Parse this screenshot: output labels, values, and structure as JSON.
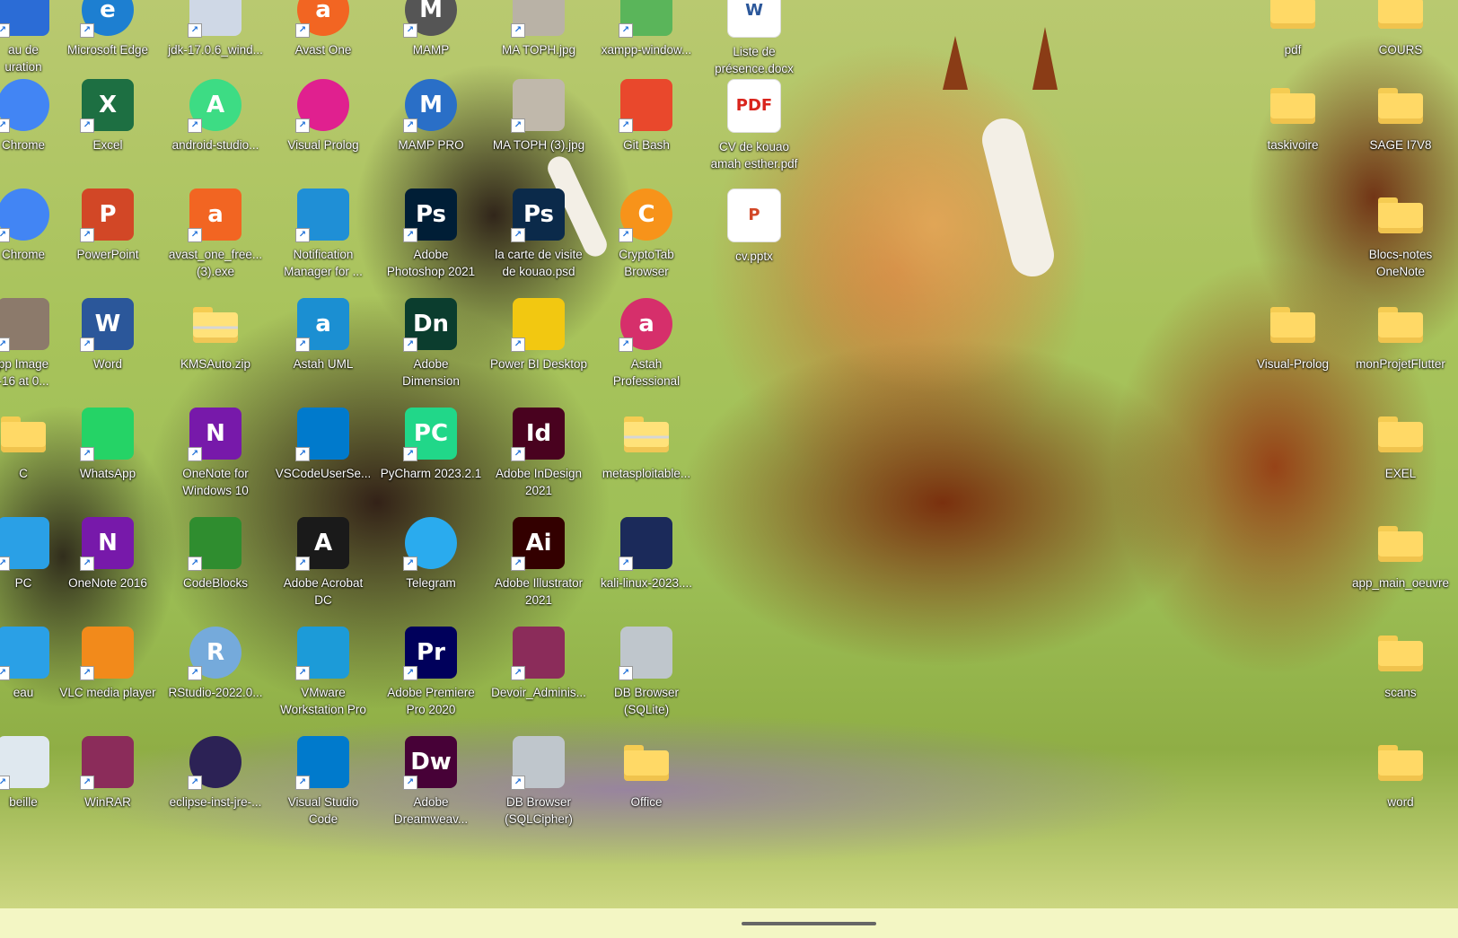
{
  "desktop": {
    "icons": [
      {
        "label": "au de\nuration",
        "name": "icon-control-panel",
        "color": "#2b6cd6",
        "glyph": "",
        "kind": "app"
      },
      {
        "label": "Microsoft Edge",
        "name": "icon-microsoft-edge",
        "color": "#1d7fd1",
        "glyph": "e",
        "kind": "round"
      },
      {
        "label": "jdk-17.0.6_wind...",
        "name": "icon-jdk-installer",
        "color": "#cfd8e6",
        "glyph": "",
        "kind": "app"
      },
      {
        "label": "Avast One",
        "name": "icon-avast-one",
        "color": "#f26522",
        "glyph": "a",
        "kind": "round"
      },
      {
        "label": "MAMP",
        "name": "icon-mamp",
        "color": "#555555",
        "glyph": "M",
        "kind": "round"
      },
      {
        "label": "MA TOPH.jpg",
        "name": "icon-ma-toph-jpg",
        "color": "#b9b2a6",
        "glyph": "",
        "kind": "app"
      },
      {
        "label": "xampp-window...",
        "name": "icon-xampp-installer",
        "color": "#5ab55a",
        "glyph": "",
        "kind": "app"
      },
      {
        "label": "Liste de\nprésence.docx",
        "name": "icon-liste-presence-docx",
        "color": "#2b579a",
        "glyph": "W",
        "kind": "doc"
      },
      {
        "label": "pdf",
        "name": "icon-folder-pdf",
        "kind": "folder"
      },
      {
        "label": "COURS",
        "name": "icon-folder-cours",
        "kind": "folder"
      },
      {
        "label": "Chrome",
        "name": "icon-chrome-1",
        "color": "#4285f4",
        "glyph": "",
        "kind": "round"
      },
      {
        "label": "Excel",
        "name": "icon-excel",
        "color": "#1d6f42",
        "glyph": "X",
        "kind": "app"
      },
      {
        "label": "android-studio...",
        "name": "icon-android-studio",
        "color": "#3ddc84",
        "glyph": "A",
        "kind": "round"
      },
      {
        "label": "Visual Prolog",
        "name": "icon-visual-prolog",
        "color": "#e0208f",
        "glyph": "",
        "kind": "round"
      },
      {
        "label": "MAMP PRO",
        "name": "icon-mamp-pro",
        "color": "#2a6fc7",
        "glyph": "M",
        "kind": "round"
      },
      {
        "label": "MA TOPH (3).jpg",
        "name": "icon-ma-toph-3-jpg",
        "color": "#c0b8ab",
        "glyph": "",
        "kind": "app"
      },
      {
        "label": "Git Bash",
        "name": "icon-git-bash",
        "color": "#e9482c",
        "glyph": "",
        "kind": "app"
      },
      {
        "label": "CV de kouao\namah esther.pdf",
        "name": "icon-cv-kouao-pdf",
        "color": "#d9241c",
        "glyph": "PDF",
        "kind": "doc"
      },
      {
        "label": "taskivoire",
        "name": "icon-folder-taskivoire",
        "kind": "folder"
      },
      {
        "label": "SAGE I7V8",
        "name": "icon-folder-sage",
        "kind": "folder"
      },
      {
        "label": "Chrome",
        "name": "icon-chrome-2",
        "color": "#4285f4",
        "glyph": "",
        "kind": "round"
      },
      {
        "label": "PowerPoint",
        "name": "icon-powerpoint",
        "color": "#d24726",
        "glyph": "P",
        "kind": "app"
      },
      {
        "label": "avast_one_free...\n(3).exe",
        "name": "icon-avast-installer",
        "color": "#f26522",
        "glyph": "a",
        "kind": "app"
      },
      {
        "label": "Notification\nManager for ...",
        "name": "icon-notification-manager",
        "color": "#1f8fd6",
        "glyph": "",
        "kind": "app"
      },
      {
        "label": "Adobe\nPhotoshop 2021",
        "name": "icon-photoshop",
        "color": "#001e36",
        "glyph": "Ps",
        "kind": "app"
      },
      {
        "label": "la carte de visite\nde kouao.psd",
        "name": "icon-carte-visite-psd",
        "color": "#0b2a4a",
        "glyph": "Ps",
        "kind": "app"
      },
      {
        "label": "CryptoTab\nBrowser",
        "name": "icon-cryptotab",
        "color": "#f7931a",
        "glyph": "C",
        "kind": "round"
      },
      {
        "label": "cv.pptx",
        "name": "icon-cv-pptx",
        "color": "#d24726",
        "glyph": "P",
        "kind": "doc"
      },
      {
        "label": "Blocs-notes\nOneNote",
        "name": "icon-folder-blocs-notes",
        "kind": "folder"
      },
      {
        "label": "pp Image\n-16 at 0...",
        "name": "icon-image-file",
        "color": "#8c7a6b",
        "glyph": "",
        "kind": "app"
      },
      {
        "label": "Word",
        "name": "icon-word",
        "color": "#2b579a",
        "glyph": "W",
        "kind": "app"
      },
      {
        "label": "KMSAuto.zip",
        "name": "icon-kmsauto-zip",
        "kind": "zip"
      },
      {
        "label": "Astah UML",
        "name": "icon-astah-uml",
        "color": "#1b8fd2",
        "glyph": "a",
        "kind": "app"
      },
      {
        "label": "Adobe\nDimension",
        "name": "icon-adobe-dimension",
        "color": "#0b3d2e",
        "glyph": "Dn",
        "kind": "app"
      },
      {
        "label": "Power BI Desktop",
        "name": "icon-power-bi",
        "color": "#f2c811",
        "glyph": "",
        "kind": "app"
      },
      {
        "label": "Astah\nProfessional",
        "name": "icon-astah-professional",
        "color": "#d62f6b",
        "glyph": "a",
        "kind": "round"
      },
      {
        "label": "Visual-Prolog",
        "name": "icon-folder-visual-prolog",
        "kind": "folder"
      },
      {
        "label": "monProjetFlutter",
        "name": "icon-folder-flutter",
        "kind": "folder"
      },
      {
        "label": "C",
        "name": "icon-folder-c",
        "kind": "folder"
      },
      {
        "label": "WhatsApp",
        "name": "icon-whatsapp",
        "color": "#25d366",
        "glyph": "",
        "kind": "app"
      },
      {
        "label": "OneNote for\nWindows 10",
        "name": "icon-onenote-win10",
        "color": "#7719aa",
        "glyph": "N",
        "kind": "app"
      },
      {
        "label": "VSCodeUserSe...",
        "name": "icon-vscode-setup",
        "color": "#007acc",
        "glyph": "",
        "kind": "app"
      },
      {
        "label": "PyCharm 2023.2.1",
        "name": "icon-pycharm",
        "color": "#21d789",
        "glyph": "PC",
        "kind": "app"
      },
      {
        "label": "Adobe InDesign\n2021",
        "name": "icon-indesign",
        "color": "#49021f",
        "glyph": "Id",
        "kind": "app"
      },
      {
        "label": "metasploitable...",
        "name": "icon-metasploitable-zip",
        "kind": "zip"
      },
      {
        "label": "EXEL",
        "name": "icon-folder-exel",
        "kind": "folder"
      },
      {
        "label": "PC",
        "name": "icon-this-pc",
        "color": "#2aa0e6",
        "glyph": "",
        "kind": "app"
      },
      {
        "label": "OneNote 2016",
        "name": "icon-onenote-2016",
        "color": "#7719aa",
        "glyph": "N",
        "kind": "app"
      },
      {
        "label": "CodeBlocks",
        "name": "icon-codeblocks",
        "color": "#2f8d2f",
        "glyph": "",
        "kind": "app"
      },
      {
        "label": "Adobe Acrobat\nDC",
        "name": "icon-acrobat",
        "color": "#1a1a1a",
        "glyph": "A",
        "kind": "app"
      },
      {
        "label": "Telegram",
        "name": "icon-telegram",
        "color": "#2aabee",
        "glyph": "",
        "kind": "round"
      },
      {
        "label": "Adobe Illustrator\n2021",
        "name": "icon-illustrator",
        "color": "#330000",
        "glyph": "Ai",
        "kind": "app"
      },
      {
        "label": "kali-linux-2023....",
        "name": "icon-kali-linux",
        "color": "#1b2a5a",
        "glyph": "",
        "kind": "app"
      },
      {
        "label": "app_main_oeuvre",
        "name": "icon-folder-app-main-oeuvre",
        "kind": "folder"
      },
      {
        "label": "eau",
        "name": "icon-network",
        "color": "#2aa0e6",
        "glyph": "",
        "kind": "app"
      },
      {
        "label": "VLC media player",
        "name": "icon-vlc",
        "color": "#f28a1b",
        "glyph": "",
        "kind": "app"
      },
      {
        "label": "RStudio-2022.0...",
        "name": "icon-rstudio",
        "color": "#75aadb",
        "glyph": "R",
        "kind": "round"
      },
      {
        "label": "VMware\nWorkstation Pro",
        "name": "icon-vmware",
        "color": "#1c9bd8",
        "glyph": "",
        "kind": "app"
      },
      {
        "label": "Adobe Premiere\nPro 2020",
        "name": "icon-premiere",
        "color": "#00005b",
        "glyph": "Pr",
        "kind": "app"
      },
      {
        "label": "Devoir_Adminis...",
        "name": "icon-devoir-rar",
        "color": "#8b2c5a",
        "glyph": "",
        "kind": "app"
      },
      {
        "label": "DB Browser\n(SQLite)",
        "name": "icon-db-browser-sqlite",
        "color": "#bfc6cc",
        "glyph": "",
        "kind": "app"
      },
      {
        "label": "scans",
        "name": "icon-folder-scans",
        "kind": "folder"
      },
      {
        "label": "beille",
        "name": "icon-recycle-bin",
        "color": "#dfe8ef",
        "glyph": "",
        "kind": "app"
      },
      {
        "label": "WinRAR",
        "name": "icon-winrar",
        "color": "#8b2c5a",
        "glyph": "",
        "kind": "app"
      },
      {
        "label": "eclipse-inst-jre-...",
        "name": "icon-eclipse-installer",
        "color": "#2c2255",
        "glyph": "",
        "kind": "round"
      },
      {
        "label": "Visual Studio\nCode",
        "name": "icon-vscode",
        "color": "#007acc",
        "glyph": "",
        "kind": "app"
      },
      {
        "label": "Adobe\nDreamweav...",
        "name": "icon-dreamweaver",
        "color": "#470137",
        "glyph": "Dw",
        "kind": "app"
      },
      {
        "label": "DB Browser\n(SQLCipher)",
        "name": "icon-db-browser-sqlcipher",
        "color": "#bfc6cc",
        "glyph": "",
        "kind": "app"
      },
      {
        "label": "Office",
        "name": "icon-folder-office",
        "kind": "folder"
      },
      {
        "label": "word",
        "name": "icon-folder-word",
        "kind": "folder"
      }
    ]
  }
}
